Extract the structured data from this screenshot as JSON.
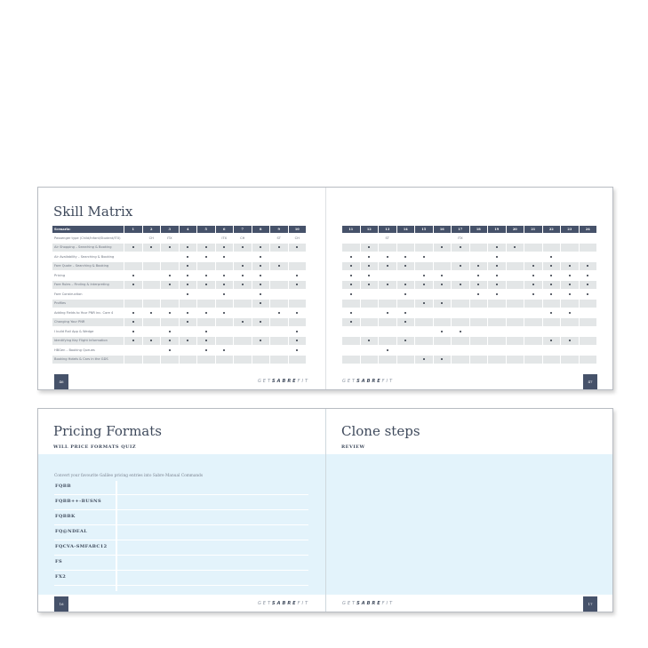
{
  "skill_matrix": {
    "title": "Skill Matrix",
    "header_label": "Scenario:",
    "left_columns": [
      "1",
      "2",
      "3",
      "4",
      "5",
      "6",
      "7",
      "8",
      "9",
      "10"
    ],
    "right_columns": [
      "11",
      "12",
      "13",
      "14",
      "15",
      "16",
      "17",
      "18",
      "19",
      "20",
      "21",
      "22",
      "23",
      "24"
    ],
    "rows": [
      {
        "label": "Passenger type (Child/Infant/Student/ITX)",
        "text": {
          "2": "CH",
          "3": "ITX",
          "6": "ITX",
          "7": "CH",
          "9": "ST",
          "10": "CH",
          "13": "ST",
          "17": "ITX"
        },
        "dots": []
      },
      {
        "label": "Air Shopping – Searching & Booking",
        "dots": [
          1,
          2,
          3,
          4,
          5,
          6,
          7,
          8,
          9,
          10,
          12,
          16,
          17,
          19,
          20
        ]
      },
      {
        "label": "Air Availability – Searching & Booking",
        "dots": [
          4,
          5,
          6,
          8,
          11,
          12,
          13,
          14,
          15,
          19,
          22
        ]
      },
      {
        "label": "Fare Quote – Searching & Booking",
        "dots": [
          4,
          7,
          8,
          9,
          11,
          12,
          13,
          14,
          17,
          18,
          19,
          21,
          22,
          23,
          24
        ]
      },
      {
        "label": "Pricing",
        "dots": [
          1,
          3,
          4,
          5,
          6,
          7,
          8,
          10,
          11,
          12,
          15,
          16,
          18,
          19,
          21,
          22,
          23,
          24
        ]
      },
      {
        "label": "Fare Rules – Finding & Interpreting",
        "dots": [
          1,
          3,
          4,
          5,
          6,
          7,
          8,
          10,
          11,
          12,
          13,
          14,
          15,
          16,
          17,
          18,
          19,
          21,
          22,
          23,
          24
        ]
      },
      {
        "label": "Fare Construction",
        "dots": [
          4,
          6,
          8,
          11,
          14,
          18,
          19,
          21,
          22,
          23,
          24
        ]
      },
      {
        "label": "Profiles",
        "dots": [
          8,
          15,
          16
        ]
      },
      {
        "label": "Adding Fields to Your PNR inc. Core 4",
        "dots": [
          1,
          2,
          3,
          4,
          5,
          6,
          9,
          10,
          11,
          13,
          14,
          22,
          23
        ]
      },
      {
        "label": "Changing Your PNR",
        "dots": [
          1,
          4,
          7,
          8,
          11,
          14
        ]
      },
      {
        "label": "I build Rail App & Wedge",
        "dots": [
          1,
          3,
          5,
          10,
          16,
          17
        ]
      },
      {
        "label": "Identifying Key Flight Information",
        "dots": [
          1,
          2,
          3,
          4,
          5,
          8,
          10,
          12,
          14,
          22,
          23
        ]
      },
      {
        "label": "HBGen – Booking Queues",
        "dots": [
          3,
          5,
          6,
          10,
          13
        ]
      },
      {
        "label": "Booking Hotels & Cars in the GDS",
        "dots": [
          15,
          16
        ]
      }
    ],
    "page_left": "46",
    "page_right": "47"
  },
  "pricing": {
    "title": "Pricing Formats",
    "subtitle": "WILL PRICE FORMATS QUIZ",
    "intro": "Convert your favourite Galileo pricing entries into Sabre Manual Commands",
    "entries": [
      "FQBB",
      "FQBB++-BUSNS",
      "FQBBK",
      "FQ@NDEAL",
      "FQCVA-SMFABC12",
      "FS",
      "FX2"
    ],
    "page": "16"
  },
  "clone": {
    "title": "Clone steps",
    "subtitle": "REVIEW",
    "page": "17"
  },
  "brand": {
    "pre": "GET",
    "mid": "SABRE",
    "post": "FIT"
  }
}
